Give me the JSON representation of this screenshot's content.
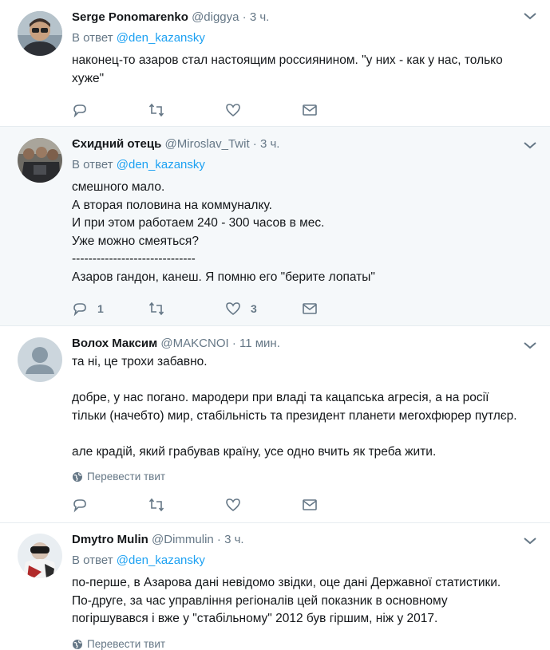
{
  "tweets": [
    {
      "name": "Serge Ponomarenko",
      "handle": "@diggya",
      "dot": "·",
      "time": "3 ч.",
      "reply_prefix": "В ответ",
      "reply_to": "@den_kazansky",
      "text": "наконец-то азаров стал настоящим россиянином. \"у них - как у нас, только\nхуже\"",
      "reply_count": "",
      "like_count": ""
    },
    {
      "name": "Єхидний отець",
      "handle": "@Miroslav_Twit",
      "dot": "·",
      "time": "3 ч.",
      "reply_prefix": "В ответ",
      "reply_to": "@den_kazansky",
      "text": "смешного мало.\nА вторая половина на коммуналку.\nИ при этом работаем 240 - 300 часов в мес.\nУже можно смеяться?\n------------------------------\nАзаров гандон, канеш. Я помню  его \"берите лопаты\"",
      "reply_count": "1",
      "like_count": "3"
    },
    {
      "name": "Волох Максим",
      "handle": "@MAKCNOI",
      "dot": "·",
      "time": "11 мин.",
      "text": "та ні,  це трохи забавно.\n\nдобре, у нас погано. мародери при владі та кацапська агресія, а на росії\nтільки (начебто) мир, стабільність та президент планети мегохфюрер путлєр.\n\nале крадій, який грабував країну,  усе одно вчить як треба жити.",
      "translate": "Перевести твит",
      "reply_count": "",
      "like_count": ""
    },
    {
      "name": "Dmytro Mulin",
      "handle": "@Dimmulin",
      "dot": "·",
      "time": "3 ч.",
      "reply_prefix": "В ответ",
      "reply_to": "@den_kazansky",
      "text": "по-перше, в Азарова дані невідомо звідки, оце дані Державної статистики.\nПо-друге, за час управління регіоналів цей показник в основному\nпогіршувався і вже у \"стабільному\" 2012 був гіршим, ніж у 2017.",
      "translate": "Перевести твит"
    }
  ],
  "icons": {
    "reply": "reply-icon",
    "retweet": "retweet-icon",
    "like": "like-icon",
    "dm": "direct-message-icon",
    "caret": "chevron-down-icon",
    "globe": "globe-icon"
  },
  "colors": {
    "link": "#1da1f2",
    "muted": "#657786",
    "highlight_bg": "#f5f8fa",
    "thread_line": "#c4e4f9"
  }
}
